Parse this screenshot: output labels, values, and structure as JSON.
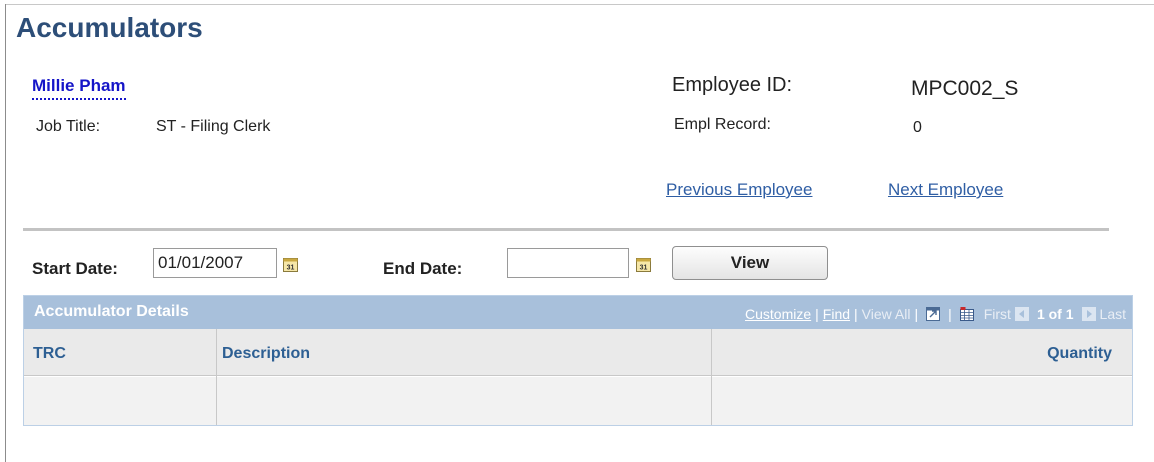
{
  "page": {
    "title": "Accumulators"
  },
  "employee": {
    "name": "Millie Pham",
    "job_title_label": "Job Title:",
    "job_title": "ST - Filing Clerk",
    "employee_id_label": "Employee ID:",
    "employee_id": "MPC002_S",
    "empl_record_label": "Empl Record:",
    "empl_record": "0"
  },
  "nav": {
    "previous": "Previous Employee",
    "next": "Next Employee"
  },
  "filters": {
    "start_date_label": "Start Date:",
    "start_date_value": "01/01/2007",
    "end_date_label": "End Date:",
    "end_date_value": "",
    "view_button": "View"
  },
  "grid": {
    "title": "Accumulator Details",
    "customize": "Customize",
    "find": "Find",
    "view_all": "View All",
    "first": "First",
    "range": "1 of 1",
    "last": "Last",
    "columns": [
      "TRC",
      "Description",
      "Quantity"
    ],
    "rows": [
      [
        "",
        "",
        ""
      ]
    ]
  },
  "colors": {
    "title": "#2d4e78",
    "link": "#2f5ea4",
    "grid_header": "#a8c0db",
    "column_header_text": "#2d5f93"
  },
  "icons": {
    "calendar": "calendar-icon",
    "zoom": "zoom-icon",
    "download": "download-spreadsheet-icon",
    "prev": "arrow-left-icon",
    "next": "arrow-right-icon"
  }
}
